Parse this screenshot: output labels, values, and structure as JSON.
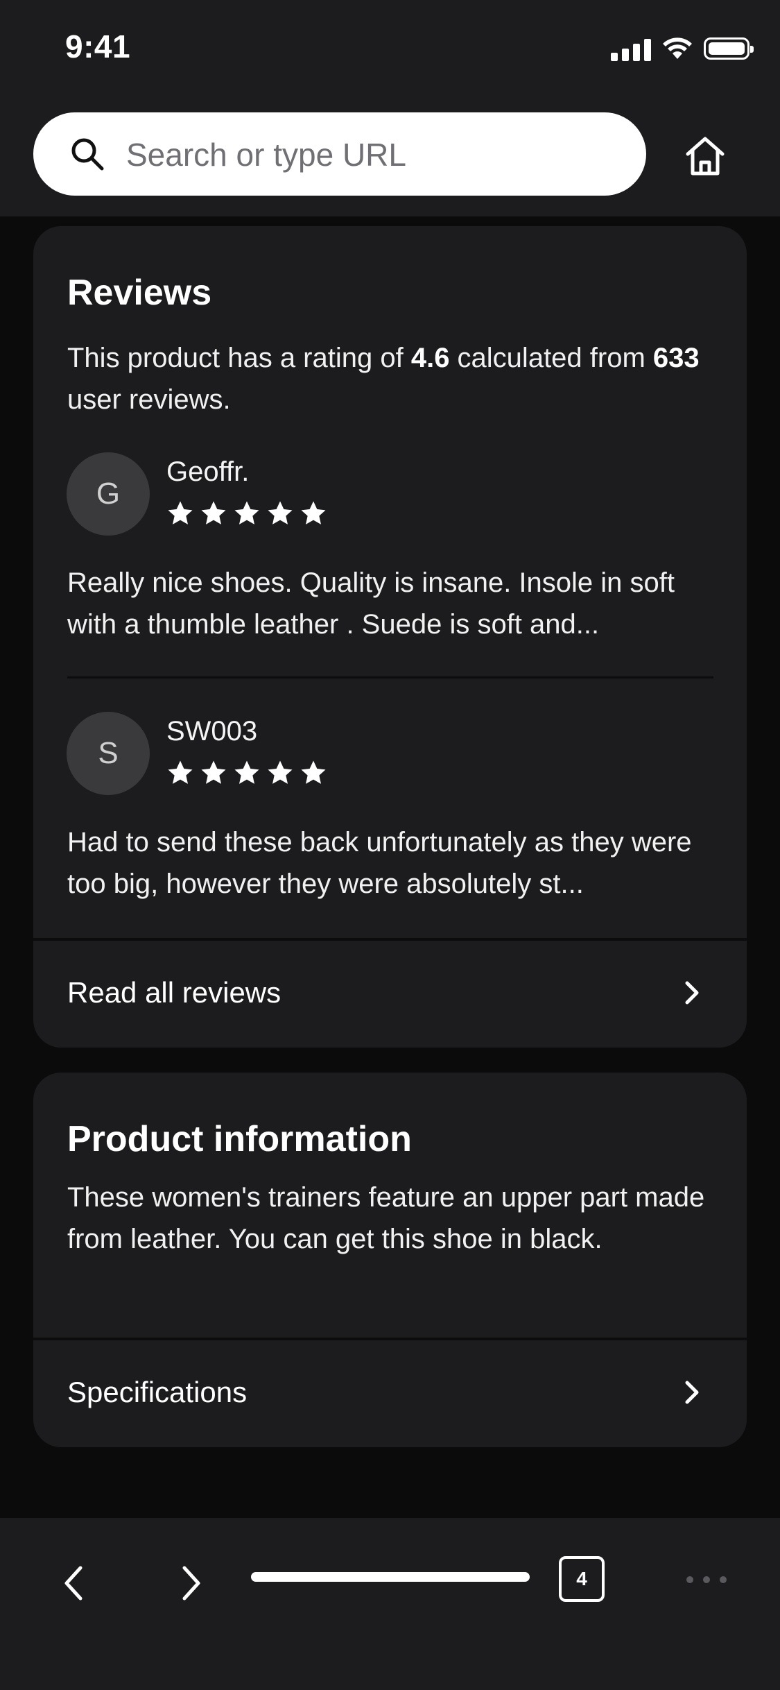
{
  "status_bar": {
    "time": "9:41"
  },
  "search": {
    "placeholder": "Search or type URL"
  },
  "reviews": {
    "title": "Reviews",
    "summary_prefix": "This product has a rating of ",
    "rating": "4.6",
    "summary_mid": " calculated from",
    "count": "633",
    "summary_suffix": " user reviews.",
    "items": [
      {
        "initial": "G",
        "name": "Geoffr.",
        "stars": 5,
        "text": "Really nice shoes. Quality is insane. Insole in soft with a thumble leather . Suede is soft and..."
      },
      {
        "initial": "S",
        "name": "SW003",
        "stars": 5,
        "text": "Had to send these back unfortunately as they were too big, however they were absolutely st..."
      }
    ],
    "read_all_label": "Read all reviews"
  },
  "product_info": {
    "title": "Product information",
    "description": "These women's trainers feature an upper part made from leather. You can get this shoe in black.",
    "specifications_label": "Specifications"
  },
  "toolbar": {
    "tab_count": "4"
  },
  "colors": {
    "background": "#0b0b0c",
    "card": "#1c1c1e",
    "avatar": "#3a3a3c",
    "text": "#ffffff"
  },
  "icons": [
    "search-icon",
    "home-icon",
    "star-icon",
    "chevron-right-icon",
    "back-icon",
    "forward-icon",
    "tabs-icon",
    "more-icon"
  ]
}
